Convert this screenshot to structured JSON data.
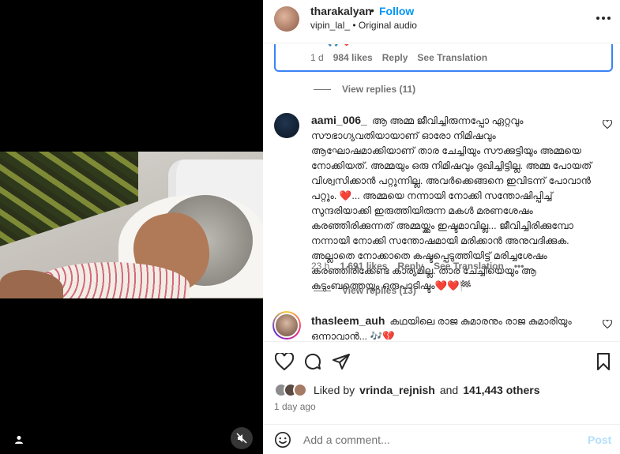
{
  "header": {
    "username": "tharakalyan",
    "dot": "•",
    "follow_label": "Follow",
    "sub_user": "vipin_lal_",
    "sub_audio": "• Original audio",
    "more_icon": "more-horizontal-icon"
  },
  "highlighted_comment": {
    "emoji": "🙏🏻❤️",
    "time": "1 d",
    "likes": "984 likes",
    "reply_label": "Reply",
    "translation_label": "See Translation",
    "view_replies": "View replies (11)"
  },
  "comments": [
    {
      "username": "aami_006_",
      "text": "ആ അമ്മ ജീവിച്ചിരുന്നപ്പോ ഏറ്റവും സൗഭാഗ്യവതിയായാണ് ഓരോ നിമിഷവും ആഘോഷമാക്കിയാണ് താര ചേച്ചിയും സൗക്കുട്ടിയും അമ്മയെ നോക്കിയത്. അമ്മയും ഒരു നിമിഷവും ദുഖിച്ചിട്ടില്ല. അമ്മ പോയത് വിശ്വസിക്കാൻ പറ്റുന്നില്ല. അവർക്കെങ്ങനെ ഇവിടന്ന് പോവാൻ പറ്റും. ❤️... അമ്മയെ നന്നായി നോക്കി സന്തോഷിപ്പിച്ച് സുന്ദരിയാക്കി ഇരുത്തിയിരുന്ന മകൾ മരണശേഷം കരഞ്ഞിരിക്കുന്നത് അമ്മയ്ക്കും ഇഷ്ടമാവില്ല... ജീവിച്ചിരിക്കുമ്പോ നന്നായി നോക്കി സന്തോഷമായി മരിക്കാൻ അനുവദിക്കുക. അല്ലാതെ നോക്കാതെ കഷ്ടപ്പെടുത്തിയിട്ട് മരിച്ചശേഷം കരഞ്ഞിരിക്കേണ്ട കാര്യമില്ല. താര ചേച്ചിയെയും ആ കുടുംബത്തെയും ഒരുപാടിഷ്ടം❤️❤️🏁",
      "time": "23 h",
      "likes": "1,691 likes",
      "reply_label": "Reply",
      "translation_label": "See Translation",
      "more": "•••",
      "view_replies": "View replies (13)"
    },
    {
      "username": "thasleem_auh",
      "text": "കഥയിലെ രാജ കുമാരനും രാജ കുമാരിയും ഒന്നാവാൻ... 🎶💔"
    }
  ],
  "actions": {
    "liked_by_prefix": "Liked by",
    "liked_by_user": "vrinda_rejnish",
    "liked_by_and": "and",
    "liked_by_count": "141,443 others",
    "time_ago": "1 day ago"
  },
  "add_comment": {
    "placeholder": "Add a comment...",
    "post_label": "Post"
  },
  "colors": {
    "accent": "#0095f6",
    "highlight_border": "#3b82f6",
    "muted": "#737373",
    "like_red": "#ed4956"
  }
}
